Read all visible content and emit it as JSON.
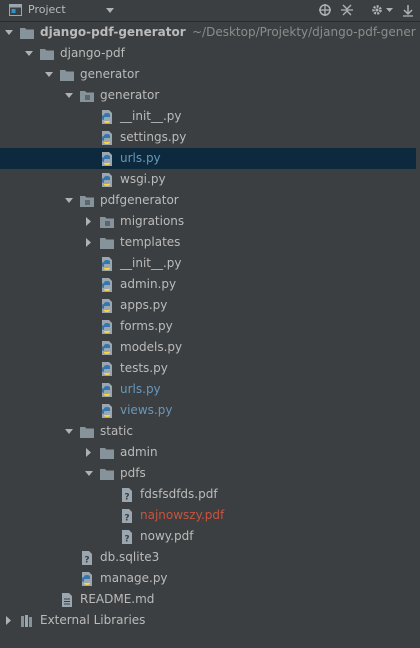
{
  "header": {
    "title": "Project",
    "icons": [
      "project-icon",
      "dropdown-icon",
      "locate-icon",
      "collapse-all-icon",
      "settings-icon",
      "hide-icon"
    ]
  },
  "tree": [
    {
      "label": "django-pdf-generator",
      "suffix": "~/Desktop/Projekty/django-pdf-generator",
      "type": "folder",
      "level": 0,
      "expanded": true,
      "bold": true
    },
    {
      "label": "django-pdf",
      "type": "folder",
      "level": 1,
      "expanded": true
    },
    {
      "label": "generator",
      "type": "folder",
      "level": 2,
      "expanded": true
    },
    {
      "label": "generator",
      "type": "package",
      "level": 3,
      "expanded": true
    },
    {
      "label": "__init__.py",
      "type": "python",
      "level": 4
    },
    {
      "label": "settings.py",
      "type": "python",
      "level": 4
    },
    {
      "label": "urls.py",
      "type": "python",
      "level": 4,
      "color": "blue",
      "selected": true
    },
    {
      "label": "wsgi.py",
      "type": "python",
      "level": 4
    },
    {
      "label": "pdfgenerator",
      "type": "package",
      "level": 3,
      "expanded": true
    },
    {
      "label": "migrations",
      "type": "package",
      "level": 4,
      "expanded": false
    },
    {
      "label": "templates",
      "type": "folder",
      "level": 4,
      "expanded": false
    },
    {
      "label": "__init__.py",
      "type": "python",
      "level": 4
    },
    {
      "label": "admin.py",
      "type": "python",
      "level": 4
    },
    {
      "label": "apps.py",
      "type": "python",
      "level": 4
    },
    {
      "label": "forms.py",
      "type": "python",
      "level": 4
    },
    {
      "label": "models.py",
      "type": "python",
      "level": 4
    },
    {
      "label": "tests.py",
      "type": "python",
      "level": 4
    },
    {
      "label": "urls.py",
      "type": "python",
      "level": 4,
      "color": "blue"
    },
    {
      "label": "views.py",
      "type": "python",
      "level": 4,
      "color": "blue"
    },
    {
      "label": "static",
      "type": "folder",
      "level": 3,
      "expanded": true
    },
    {
      "label": "admin",
      "type": "folder",
      "level": 4,
      "expanded": false
    },
    {
      "label": "pdfs",
      "type": "folder",
      "level": 4,
      "expanded": true
    },
    {
      "label": "fdsfsdfds.pdf",
      "type": "unknown",
      "level": 5
    },
    {
      "label": "najnowszy.pdf",
      "type": "unknown",
      "level": 5,
      "color": "red"
    },
    {
      "label": "nowy.pdf",
      "type": "unknown",
      "level": 5
    },
    {
      "label": "db.sqlite3",
      "type": "unknown",
      "level": 3
    },
    {
      "label": "manage.py",
      "type": "python",
      "level": 3
    },
    {
      "label": "README.md",
      "type": "text",
      "level": 2
    },
    {
      "label": "External Libraries",
      "type": "library",
      "level": 0,
      "expanded": false
    }
  ],
  "colors": {
    "background": "#3c3f41",
    "selection": "#0d293e",
    "folder": "#87939a",
    "blue_text": "#6897bb",
    "red_text": "#c7543e"
  }
}
